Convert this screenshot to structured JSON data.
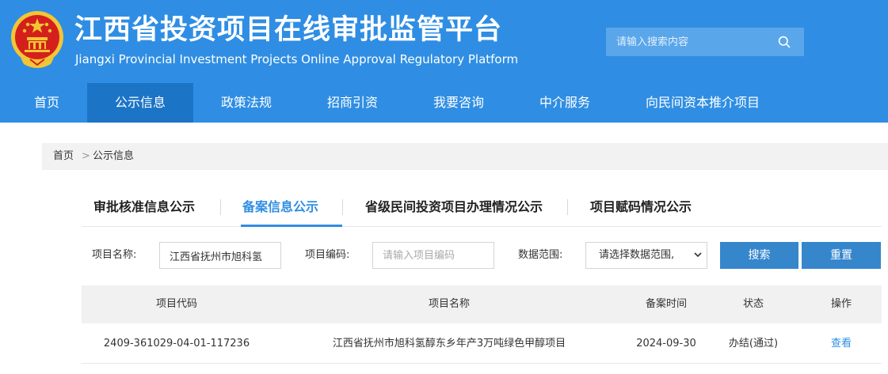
{
  "header": {
    "title": "江西省投资项目在线审批监管平台",
    "subtitle": "Jiangxi Provincial Investment Projects Online Approval Regulatory Platform",
    "search_placeholder": "请输入搜索内容"
  },
  "nav": {
    "items": [
      {
        "label": "首页"
      },
      {
        "label": "公示信息",
        "active": true
      },
      {
        "label": "政策法规"
      },
      {
        "label": "招商引资"
      },
      {
        "label": "我要咨询"
      },
      {
        "label": "中介服务"
      },
      {
        "label": "向民间资本推介项目"
      }
    ]
  },
  "breadcrumb": {
    "home": "首页",
    "separator": ">",
    "current": "公示信息"
  },
  "tabs": [
    {
      "label": "审批核准信息公示"
    },
    {
      "label": "备案信息公示",
      "active": true
    },
    {
      "label": "省级民间投资项目办理情况公示"
    },
    {
      "label": "项目赋码情况公示"
    }
  ],
  "filters": {
    "project_name_label": "项目名称:",
    "project_name_value": "江西省抚州市旭科氢",
    "project_code_label": "项目编码:",
    "project_code_placeholder": "请输入项目编码",
    "data_range_label": "数据范围:",
    "data_range_value": "请选择数据范围,",
    "search_button": "搜索",
    "reset_button": "重置"
  },
  "table": {
    "columns": [
      "项目代码",
      "项目名称",
      "备案时间",
      "状态",
      "操作"
    ],
    "rows": [
      {
        "code": "2409-361029-04-01-117236",
        "name": "江西省抚州市旭科氢醇东乡年产3万吨绿色甲醇项目",
        "date": "2024-09-30",
        "status": "办结(通过)",
        "action": "查看"
      }
    ]
  },
  "colors": {
    "brand_blue": "#2f8ee3",
    "nav_active": "#1c74c6",
    "button_blue": "#3686cc",
    "emblem_red": "#d4201c",
    "emblem_gold": "#f4c534"
  },
  "icons": {
    "emblem": "national-emblem-icon",
    "search": "search-icon",
    "select_arrow": "chevron-down-icon"
  }
}
